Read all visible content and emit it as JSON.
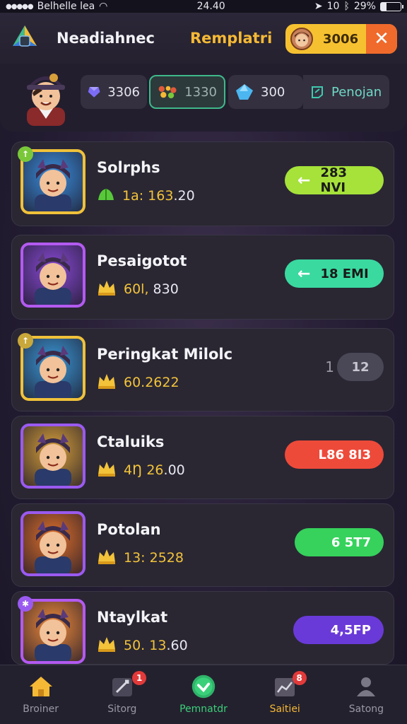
{
  "status_bar": {
    "carrier": "Belhelle lea",
    "time": "24.40",
    "indicators": "10",
    "battery": "29%",
    "battery_level": 0.29
  },
  "header": {
    "app_name": "Neadiahnec",
    "tab_title": "Remplatri",
    "coins": "3006",
    "close_icon": "close-icon"
  },
  "profile": {
    "stats": [
      {
        "icon": "gem-icon",
        "value": "3306",
        "color": "#7b6cf5"
      },
      {
        "icon": "items-icon",
        "value": "1330",
        "color": "#e05a3a",
        "active": true
      },
      {
        "icon": "crystal-icon",
        "value": "300",
        "color": "#4bb6f0"
      },
      {
        "icon": "edit-icon",
        "value": "Penojan",
        "color": "#3fc9b0"
      }
    ]
  },
  "leaderboard": [
    {
      "name": "Solrphs",
      "score_main": "1a: 163",
      "score_tail": ".20",
      "score_icon": "leaf-icon",
      "action": "283 NVI",
      "btn_color": "#a6e23a",
      "has_arrow": true,
      "avatar_bg": "#3a8fe0",
      "frame": "#f0c13a",
      "badge": "↑",
      "badge_color": "#7ac83a"
    },
    {
      "name": "Pesaigotot",
      "score_main": "60l, ",
      "score_tail": "830",
      "score_icon": "crown-icon",
      "action": "18 EMI",
      "btn_color": "#3ad9a0",
      "has_arrow": true,
      "avatar_bg": "#8a4ad8",
      "frame": "#b35af0",
      "badge": "",
      "badge_color": ""
    },
    {
      "name": "Peringkat Milolc",
      "score_main": "60.2622",
      "score_tail": "",
      "score_icon": "crown-icon",
      "action": "12",
      "action_prefix": "1",
      "btn_color": "#4a4856",
      "has_arrow": false,
      "avatar_bg": "#3a98d8",
      "frame": "#f0c13a",
      "badge": "↑",
      "badge_color": "#c8a83a"
    },
    {
      "name": "Ctaluiks",
      "score_main": "4Ŋ 26",
      "score_tail": ".00",
      "score_icon": "crown-icon",
      "action": "L86 8I3",
      "btn_color": "#ee4a3a",
      "has_arrow": false,
      "avatar_bg": "#d8a03a",
      "frame": "#9a5af0",
      "badge": "",
      "badge_color": ""
    },
    {
      "name": "Potolan",
      "score_main": "13: 2528",
      "score_tail": "",
      "score_icon": "crown-icon",
      "action": "6 5T7",
      "btn_color": "#36d25c",
      "has_arrow": false,
      "avatar_bg": "#e0702a",
      "frame": "#9a5af0",
      "badge": "",
      "badge_color": ""
    },
    {
      "name": "Ntaylkat",
      "score_main": "50. 13",
      "score_tail": ".60",
      "score_icon": "crown-icon",
      "action": "4,5FP",
      "btn_color": "#6a3ad8",
      "has_arrow": false,
      "avatar_bg": "#f08a3a",
      "frame": "#b35af0",
      "badge": "✱",
      "badge_color": "#9a5af0"
    }
  ],
  "nav": [
    {
      "label": "Broiner",
      "icon": "home-icon",
      "badge": "",
      "active": false
    },
    {
      "label": "Sitorg",
      "icon": "battle-icon",
      "badge": "1",
      "active": false
    },
    {
      "label": "Pemnatdr",
      "icon": "check-icon",
      "badge": "",
      "active": true
    },
    {
      "label": "Saitiei",
      "icon": "chart-icon",
      "badge": "8",
      "active": false
    },
    {
      "label": "Satong",
      "icon": "profile-icon",
      "badge": "",
      "active": false
    }
  ]
}
